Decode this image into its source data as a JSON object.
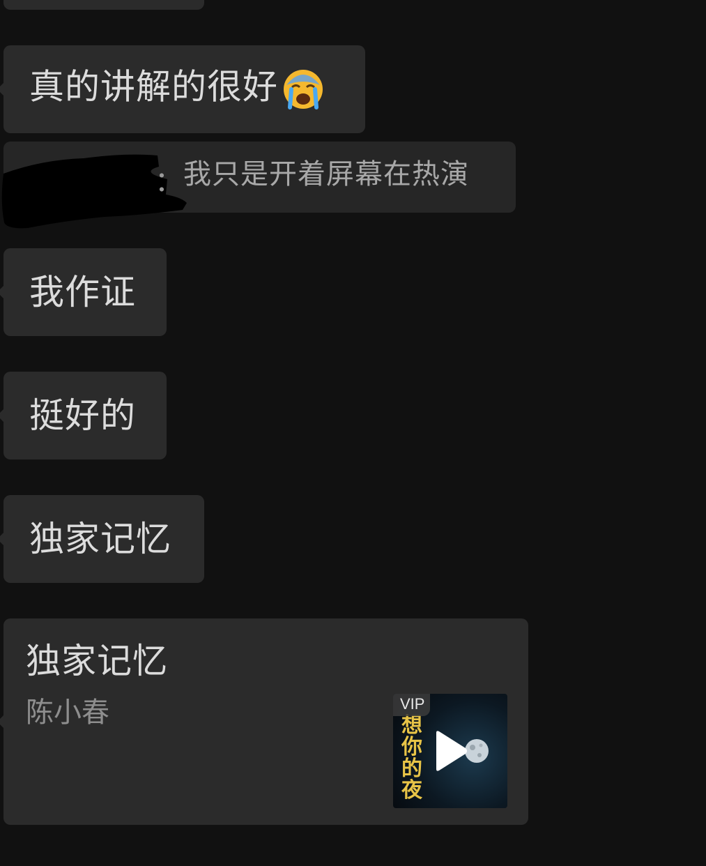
{
  "messages": [
    {
      "id": "m1",
      "text": "真的讲解的很好",
      "emoji": "loudly-crying-face"
    },
    {
      "id": "m2",
      "text": "我作证"
    },
    {
      "id": "m3",
      "text": "挺好的"
    },
    {
      "id": "m4",
      "text": "独家记忆"
    }
  ],
  "quote": {
    "separator": "：",
    "text": "我只是开着屏幕在热演"
  },
  "music_card": {
    "title": "独家记忆",
    "artist": "陈小春",
    "badge": "VIP",
    "cover_text": "想你的夜",
    "icon": "play-icon"
  },
  "colors": {
    "background": "#111111",
    "bubble": "#2b2b2b",
    "text": "#dcdcdc",
    "secondary_text": "#8e8e8e",
    "cover_text": "#e8c447"
  }
}
